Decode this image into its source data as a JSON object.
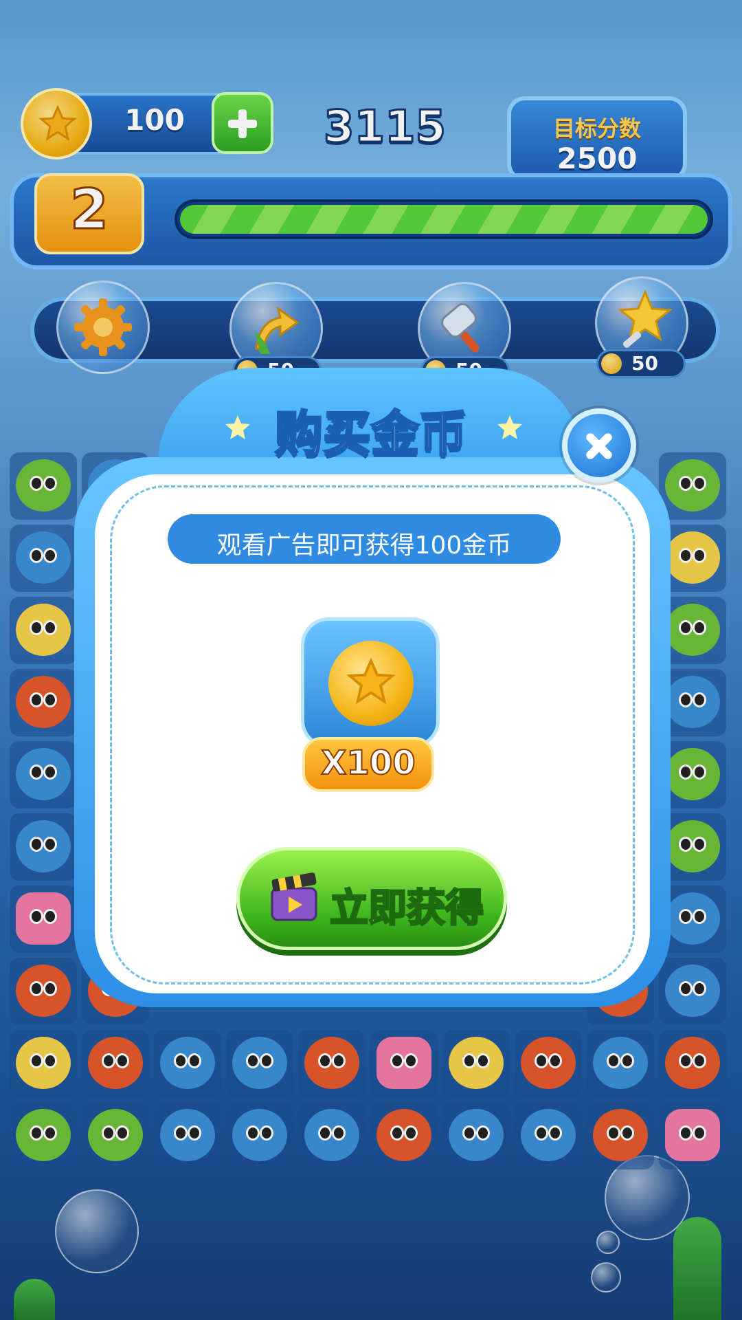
{
  "hud": {
    "coins": "100",
    "score": "3115",
    "target_label": "目标分数",
    "target_value": "2500",
    "level": "2",
    "progress": 1.0
  },
  "tools": [
    {
      "name": "settings",
      "icon": "gear-icon"
    },
    {
      "name": "shuffle",
      "icon": "refresh-arrows-icon",
      "price": "50"
    },
    {
      "name": "hammer",
      "icon": "hammer-icon",
      "price": "50"
    },
    {
      "name": "magic",
      "icon": "star-wand-icon",
      "price": "50"
    }
  ],
  "dialog": {
    "title": "购买金币",
    "hint": "观看广告即可获得100金币",
    "reward_amount": "X100",
    "button_label": "立即获得",
    "button_icon": "clapperboard-icon",
    "close_icon": "close-icon"
  },
  "board": {
    "rows_visible": [
      [
        "turtle",
        "whale",
        "",
        "",
        "",
        "",
        "",
        "",
        "",
        "turtle"
      ],
      [
        "whale",
        "",
        "",
        "",
        "",
        "",
        "",
        "",
        "",
        "pufferfish"
      ],
      [
        "pufferfish",
        "",
        "",
        "",
        "",
        "",
        "",
        "",
        "",
        "turtle"
      ],
      [
        "crab",
        "",
        "",
        "",
        "",
        "",
        "",
        "",
        "",
        "whale"
      ],
      [
        "whale",
        "",
        "",
        "",
        "",
        "",
        "",
        "",
        "",
        "turtle"
      ],
      [
        "whale",
        "",
        "",
        "",
        "",
        "",
        "",
        "",
        "",
        "turtle"
      ],
      [
        "starfish",
        "",
        "",
        "",
        "",
        "",
        "",
        "",
        "",
        "whale"
      ],
      [
        "crab",
        "crab",
        "",
        "",
        "",
        "",
        "",
        "",
        "crab",
        "whale"
      ],
      [
        "pufferfish",
        "crab",
        "whale",
        "whale",
        "crab",
        "starfish",
        "pufferfish",
        "crab",
        "whale",
        "crab"
      ],
      [
        "turtle",
        "turtle",
        "whale",
        "whale",
        "whale",
        "crab",
        "whale",
        "whale",
        "crab",
        "starfish"
      ]
    ]
  },
  "colors": {
    "turtle": "#6fbf3c",
    "whale": "#3d8fd6",
    "pufferfish": "#f4d04a",
    "crab": "#e3582c",
    "starfish": "#f07ca8"
  }
}
